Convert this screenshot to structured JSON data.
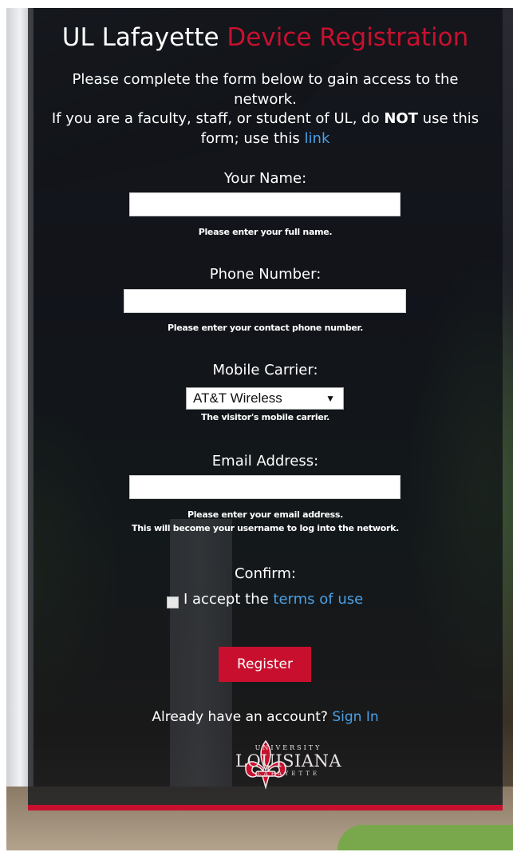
{
  "header": {
    "title_main": "UL Lafayette",
    "title_accent": "Device Registration"
  },
  "intro": {
    "line1": "Please complete the form below to gain access to the network.",
    "line2_pre": "If you are a faculty, staff, or student of UL, do ",
    "line2_bold": "NOT",
    "line2_post": " use this form; use this ",
    "link_text": "link"
  },
  "form": {
    "name": {
      "label": "Your Name:",
      "value": "",
      "help": "Please enter your full name."
    },
    "phone": {
      "label": "Phone Number:",
      "value": "",
      "help": "Please enter your contact phone number."
    },
    "carrier": {
      "label": "Mobile Carrier:",
      "selected": "AT&T Wireless",
      "help": "The visitor's mobile carrier."
    },
    "email": {
      "label": "Email Address:",
      "value": "",
      "help_line1": "Please enter your email address.",
      "help_line2": "This will become your username to log into the network."
    },
    "confirm": {
      "label": "Confirm:",
      "accept_text": "I accept the ",
      "terms_link": "terms of use",
      "checked": false
    },
    "register_label": "Register"
  },
  "footer": {
    "account_text": "Already have an account? ",
    "signin_link": "Sign In",
    "logo_top": "UNIVERSITY",
    "logo_main": "LOUISIANA",
    "logo_bottom": "LAFAYETTE"
  },
  "colors": {
    "accent_red": "#c8102e",
    "link_blue": "#4aa0e6"
  }
}
